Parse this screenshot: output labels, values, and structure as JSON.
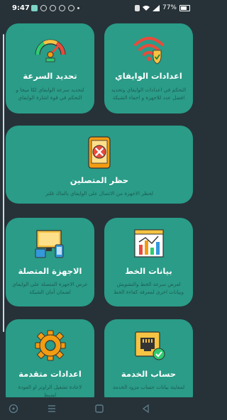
{
  "status_bar": {
    "time": "9:47",
    "battery": "77%"
  },
  "cards": {
    "wifi_settings": {
      "title": "اعدادات الوايفاي",
      "description": "التحكم في اعدادات الوايفاي وتحديد افضل عدد للاجهزة و اخفاء الشبكة"
    },
    "speed_limit": {
      "title": "تحديد السرعة",
      "description": "لتحديد سرعة الوايفاي لكا ميجا و التحكم في قوة اشارة الوايفاي"
    },
    "block_users": {
      "title": "حظر المتصلين",
      "description": "لحظر الاجهزة من الاتصال على الوايفاي بالماك فلتر"
    },
    "line_data": {
      "title": "بيانات الخط",
      "description": "لعرض سرعة الخط والتشويش وبيانات اخرى لمعرفة كفاءة الخط"
    },
    "connected_devices": {
      "title": "الاجهزة المتصلة",
      "description": "عرض الاجهزة المتصلة على الوايفاي لضمان أمان الشبكة"
    },
    "service_account": {
      "title": "حساب الخدمة",
      "description": "لمعاينة بيانات حساب مزود الخدمة"
    },
    "advanced_settings": {
      "title": "اعدادات متقدمة",
      "description": "لاعادة تشغيل الراوتر او العودة لضبط"
    }
  },
  "colors": {
    "background": "#263238",
    "card": "#2a9c88",
    "card_text": "#ffffff",
    "card_desc": "#1d5d53",
    "accent_orange": "#f39c12",
    "accent_red": "#e74c3c",
    "accent_yellow": "#f6c343"
  },
  "icons": {
    "wifi": "wifi-shield-icon",
    "speed": "speedometer-icon",
    "block": "phone-block-icon",
    "chart": "line-chart-icon",
    "devices": "devices-icon",
    "service": "ethernet-port-icon",
    "settings": "gear-icon"
  }
}
